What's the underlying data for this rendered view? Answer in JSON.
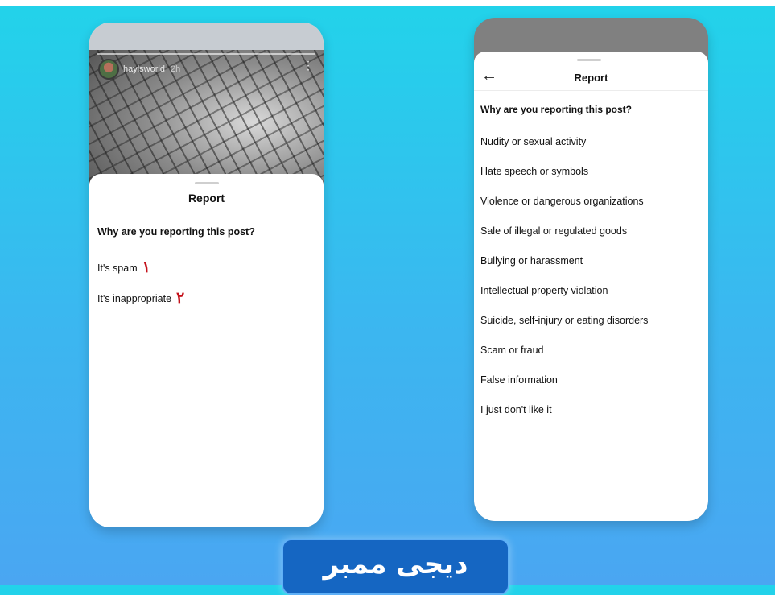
{
  "left_phone": {
    "story": {
      "username": "haylsworld",
      "time": "2h",
      "menu_icon": "⋮"
    },
    "sheet": {
      "title": "Report",
      "question": "Why are you reporting this post?",
      "options": [
        {
          "label": "It's spam",
          "marker": "۱"
        },
        {
          "label": "It's inappropriate",
          "marker": "۲"
        }
      ]
    }
  },
  "right_phone": {
    "sheet": {
      "back_icon": "←",
      "title": "Report",
      "question": "Why are you reporting this post?",
      "options": [
        "Nudity or sexual activity",
        "Hate speech or symbols",
        "Violence or dangerous organizations",
        "Sale of illegal or regulated goods",
        "Bullying or harassment",
        "Intellectual property violation",
        "Suicide, self-injury or eating disorders",
        "Scam or fraud",
        "False information",
        "I just don't like it"
      ]
    }
  },
  "brand": {
    "text": "دیجی ممبر"
  },
  "colors": {
    "background_top": "#22d3ea",
    "background_bottom": "#4aa6f2",
    "marker_red": "#c4111a",
    "brand_blue": "#1566c2"
  }
}
